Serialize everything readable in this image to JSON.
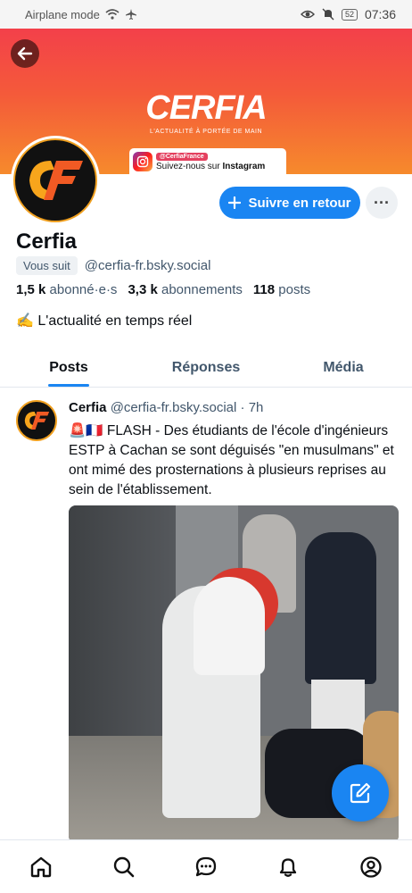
{
  "status_bar": {
    "airplane_label": "Airplane mode",
    "battery": "52",
    "time": "07:36"
  },
  "banner": {
    "logo": "CERFIA",
    "tagline": "L'ACTUALITÉ À PORTÉE DE MAIN",
    "instagram_handle": "@CerfiaFrance",
    "instagram_cta_prefix": "Suivez-nous sur ",
    "instagram_cta_bold": "Instagram"
  },
  "profile": {
    "display_name": "Cerfia",
    "follows_you": "Vous suit",
    "handle": "@cerfia-fr.bsky.social",
    "followers_count": "1,5 k",
    "followers_label": "abonné·e·s",
    "following_count": "3,3 k",
    "following_label": "abonnements",
    "posts_count": "118",
    "posts_label": "posts",
    "bio": "✍️ L'actualité en temps réel",
    "follow_back_label": "Suivre en retour",
    "more_label": "···"
  },
  "tabs": [
    {
      "label": "Posts",
      "active": true
    },
    {
      "label": "Réponses",
      "active": false
    },
    {
      "label": "Média",
      "active": false
    }
  ],
  "post": {
    "author": "Cerfia",
    "handle": "@cerfia-fr.bsky.social",
    "time": "· 7h",
    "text": "🚨🇫🇷 FLASH - Des étudiants de l'école d'ingénieurs ESTP à Cachan se sont déguisés \"en musulmans\" et ont mimé des prosternations à plusieurs reprises au sein de l'établissement."
  },
  "icons": {
    "back": "arrow-left-icon",
    "plus": "plus-icon",
    "compose": "compose-icon",
    "nav": [
      "home-icon",
      "search-icon",
      "chat-icon",
      "bell-icon",
      "profile-icon"
    ]
  },
  "colors": {
    "accent": "#1a85f2",
    "banner_top": "#f3404a",
    "banner_bottom": "#f68a2c",
    "muted_text": "#42576c"
  }
}
